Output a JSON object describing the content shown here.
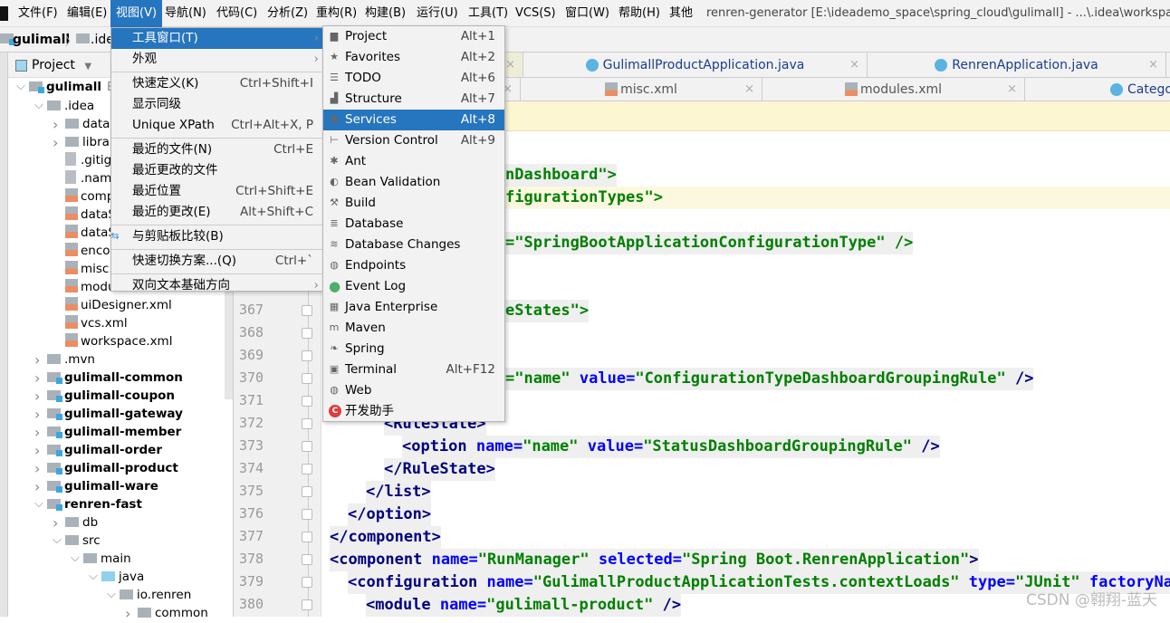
{
  "menubar": {
    "items": [
      "文件(F)",
      "编辑(E)",
      "视图(V)",
      "导航(N)",
      "代码(C)",
      "分析(Z)",
      "重构(R)",
      "构建(B)",
      "运行(U)",
      "工具(T)",
      "VCS(S)",
      "窗口(W)",
      "帮助(H)",
      "其他"
    ],
    "active": "视图(V)",
    "title": "renren-generator [E:\\ideademo_space\\spring_cloud\\gulimall] - ...\\.idea\\workspace.xml"
  },
  "breadcrumb": [
    "gulimall",
    ".idea"
  ],
  "project_panel": {
    "title": "Project",
    "root_hint": "E:\\"
  },
  "tree": [
    {
      "label": "gulimall",
      "depth": 0,
      "icon": "module",
      "open": true,
      "bold": true
    },
    {
      "label": ".idea",
      "depth": 1,
      "icon": "folder",
      "open": true
    },
    {
      "label": "dataS",
      "depth": 2,
      "icon": "folder",
      "open": false
    },
    {
      "label": "librari",
      "depth": 2,
      "icon": "folder",
      "open": false
    },
    {
      "label": ".gitigr",
      "depth": 2,
      "icon": "file"
    },
    {
      "label": ".name",
      "depth": 2,
      "icon": "file"
    },
    {
      "label": "comp",
      "depth": 2,
      "icon": "xml"
    },
    {
      "label": "dataS",
      "depth": 2,
      "icon": "xml"
    },
    {
      "label": "dataS",
      "depth": 2,
      "icon": "xml"
    },
    {
      "label": "encod",
      "depth": 2,
      "icon": "xml"
    },
    {
      "label": "misc.x",
      "depth": 2,
      "icon": "xml"
    },
    {
      "label": "modu",
      "depth": 2,
      "icon": "xml"
    },
    {
      "label": "uiDesigner.xml",
      "depth": 2,
      "icon": "xml"
    },
    {
      "label": "vcs.xml",
      "depth": 2,
      "icon": "xml"
    },
    {
      "label": "workspace.xml",
      "depth": 2,
      "icon": "xml"
    },
    {
      "label": ".mvn",
      "depth": 1,
      "icon": "folder",
      "open": false
    },
    {
      "label": "gulimall-common",
      "depth": 1,
      "icon": "module",
      "open": false,
      "bold": true
    },
    {
      "label": "gulimall-coupon",
      "depth": 1,
      "icon": "module",
      "open": false,
      "bold": true
    },
    {
      "label": "gulimall-gateway",
      "depth": 1,
      "icon": "module",
      "open": false,
      "bold": true
    },
    {
      "label": "gulimall-member",
      "depth": 1,
      "icon": "module",
      "open": false,
      "bold": true
    },
    {
      "label": "gulimall-order",
      "depth": 1,
      "icon": "module",
      "open": false,
      "bold": true
    },
    {
      "label": "gulimall-product",
      "depth": 1,
      "icon": "module",
      "open": false,
      "bold": true
    },
    {
      "label": "gulimall-ware",
      "depth": 1,
      "icon": "module",
      "open": false,
      "bold": true
    },
    {
      "label": "renren-fast",
      "depth": 1,
      "icon": "module",
      "open": true,
      "bold": true
    },
    {
      "label": "db",
      "depth": 2,
      "icon": "folder",
      "open": false
    },
    {
      "label": "src",
      "depth": 2,
      "icon": "folder",
      "open": true
    },
    {
      "label": "main",
      "depth": 3,
      "icon": "folder",
      "open": true
    },
    {
      "label": "java",
      "depth": 4,
      "icon": "source",
      "open": true
    },
    {
      "label": "io.renren",
      "depth": 5,
      "icon": "package",
      "open": true
    },
    {
      "label": "common",
      "depth": 6,
      "icon": "package",
      "open": false
    }
  ],
  "tabs_row1": [
    {
      "label": "GulimallProductApplication.java"
    },
    {
      "label": "RenrenApplication.java"
    }
  ],
  "tabs_row2": [
    {
      "label": "misc.xml"
    },
    {
      "label": "modules.xml"
    },
    {
      "label": "Categor"
    }
  ],
  "line_numbers": [
    "367",
    "368",
    "369",
    "370",
    "371",
    "372",
    "373",
    "374",
    "375",
    "376",
    "377",
    "378",
    "379",
    "380"
  ],
  "view_menu": {
    "items": [
      {
        "label": "工具窗口(T)",
        "shortcut": "",
        "submenu": true,
        "highlighted": true
      },
      {
        "label": "外观",
        "shortcut": "",
        "submenu": true
      },
      {
        "label": "快速定义(K)",
        "shortcut": "Ctrl+Shift+I",
        "sep_before": true
      },
      {
        "label": "显示同级",
        "shortcut": ""
      },
      {
        "label": "Unique XPath",
        "shortcut": "Ctrl+Alt+X, P"
      },
      {
        "label": "最近的文件(N)",
        "shortcut": "Ctrl+E",
        "sep_before": true
      },
      {
        "label": "最近更改的文件",
        "shortcut": ""
      },
      {
        "label": "最近位置",
        "shortcut": "Ctrl+Shift+E"
      },
      {
        "label": "最近的更改(E)",
        "shortcut": "Alt+Shift+C"
      },
      {
        "label": "与剪贴板比较(B)",
        "shortcut": "",
        "sep_before": true,
        "icon": "clipboard-compare-icon"
      },
      {
        "label": "快速切换方案...(Q)",
        "shortcut": "Ctrl+`",
        "sep_before": true
      },
      {
        "label": "双向文本基础方向",
        "shortcut": "",
        "submenu": true,
        "sep_before": true
      }
    ]
  },
  "tool_windows_menu": {
    "items": [
      {
        "label": "Project",
        "shortcut": "Alt+1",
        "icon": "folder-icon"
      },
      {
        "label": "Favorites",
        "shortcut": "Alt+2",
        "icon": "star-icon"
      },
      {
        "label": "TODO",
        "shortcut": "Alt+6",
        "icon": "list-icon"
      },
      {
        "label": "Structure",
        "shortcut": "Alt+7",
        "icon": "structure-icon"
      },
      {
        "label": "Services",
        "shortcut": "Alt+8",
        "icon": "services-icon",
        "highlighted": true
      },
      {
        "label": "Version Control",
        "shortcut": "Alt+9",
        "icon": "vcs-icon"
      },
      {
        "label": "Ant",
        "shortcut": "",
        "icon": "ant-icon"
      },
      {
        "label": "Bean Validation",
        "shortcut": "",
        "icon": "bean-icon"
      },
      {
        "label": "Build",
        "shortcut": "",
        "icon": "hammer-icon"
      },
      {
        "label": "Database",
        "shortcut": "",
        "icon": "database-icon"
      },
      {
        "label": "Database Changes",
        "shortcut": "",
        "icon": "database-changes-icon"
      },
      {
        "label": "Endpoints",
        "shortcut": "",
        "icon": "globe-icon"
      },
      {
        "label": "Event Log",
        "shortcut": "",
        "icon": "event-log-icon"
      },
      {
        "label": "Java Enterprise",
        "shortcut": "",
        "icon": "java-enterprise-icon"
      },
      {
        "label": "Maven",
        "shortcut": "",
        "icon": "maven-icon"
      },
      {
        "label": "Spring",
        "shortcut": "",
        "icon": "spring-icon"
      },
      {
        "label": "Terminal",
        "shortcut": "Alt+F12",
        "icon": "terminal-icon"
      },
      {
        "label": "Web",
        "shortcut": "",
        "icon": "web-icon"
      },
      {
        "label": "开发助手",
        "shortcut": "",
        "icon": "dev-helper-icon"
      }
    ]
  },
  "code": {
    "l361": [
      "nDashboard\">"
    ],
    "l362": [
      "figurationTypes\">"
    ],
    "l364": [
      "=\"SpringBootApplicationConfigurationType\" />"
    ],
    "l367": [
      "eStates\">"
    ],
    "l370": [
      "=\"name\"",
      "value=",
      "\"ConfigurationTypeDashboardGroupingRule\"",
      "/>"
    ],
    "l372": [
      "<RuleState>"
    ],
    "l373": [
      "<option",
      "name=",
      "\"name\"",
      "value=",
      "\"StatusDashboardGroupingRule\"",
      "/>"
    ],
    "l374": [
      "</RuleState>"
    ],
    "l375": [
      "</list>"
    ],
    "l376": [
      "</option>"
    ],
    "l377": [
      "</component>"
    ],
    "l378": [
      "<component",
      "name=",
      "\"RunManager\"",
      "selected=",
      "\"Spring Boot.RenrenApplication\"",
      ">"
    ],
    "l379": [
      "<configuration",
      "name=",
      "\"GulimallProductApplicationTests.contextLoads\"",
      "type=",
      "\"JUnit\"",
      "factoryName"
    ],
    "l380": [
      "<module",
      "name=",
      "\"gulimall-product\"",
      "/>"
    ]
  },
  "watermark": "CSDN @翱翔-蓝天",
  "colors": {
    "accent": "#2675bf",
    "tag": "#000080",
    "attr": "#0000ff",
    "value": "#008000"
  }
}
